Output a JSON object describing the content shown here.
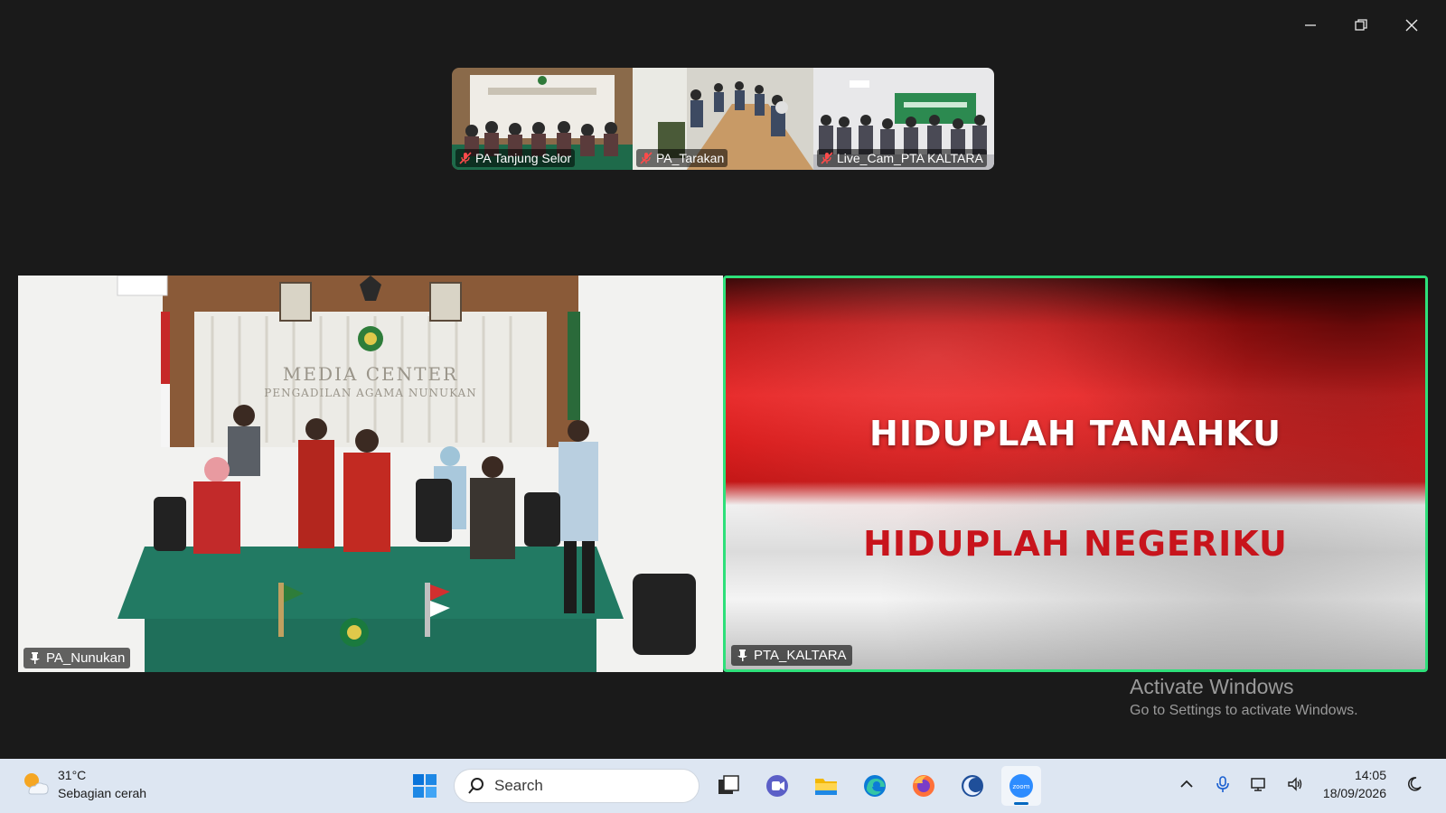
{
  "thumbnails": [
    {
      "name": "PA Tanjung Selor",
      "muted": true
    },
    {
      "name": "PA_Tarakan",
      "muted": true
    },
    {
      "name": "Live_Cam_PTA KALTARA",
      "muted": true
    }
  ],
  "main_tiles": [
    {
      "name": "PA_Nunukan",
      "pinned": true
    },
    {
      "name": "PTA_KALTARA",
      "pinned": true,
      "active_speaker": true
    }
  ],
  "flag_screen": {
    "line1": "HIDUPLAH TANAHKU",
    "line2": "HIDUPLAH NEGERIKU"
  },
  "room_signage": {
    "line1": "MEDIA CENTER",
    "line2": "PENGADILAN AGAMA NUNUKAN"
  },
  "activation_notice": {
    "title": "Activate Windows",
    "subtitle": "Go to Settings to activate Windows."
  },
  "taskbar": {
    "weather_temp": "31°C",
    "weather_desc": "Sebagian cerah",
    "search_label": "Search",
    "time": "14:05",
    "date": "18/09/2026"
  },
  "colors": {
    "active_speaker_border": "#2ee07a",
    "window_bg": "#1a1a1a",
    "taskbar_bg": "#dde6f2",
    "flag_red": "#c8141c"
  }
}
